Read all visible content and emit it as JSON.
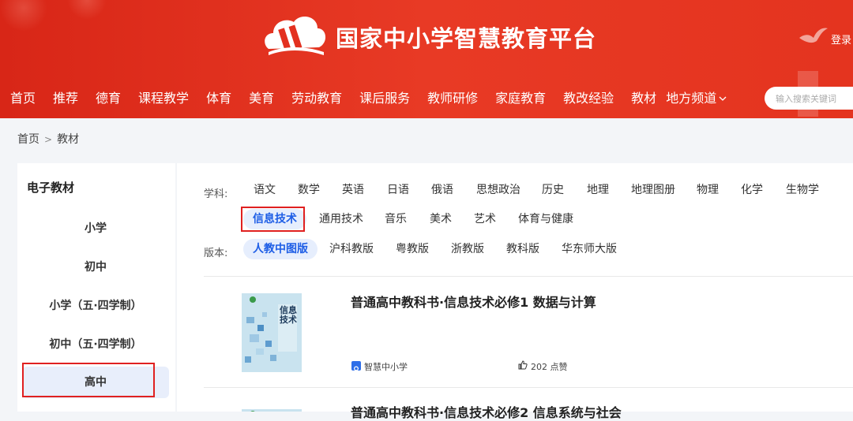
{
  "header": {
    "site_title": "国家中小学智慧教育平台",
    "login_label": "登录",
    "search_placeholder": "输入搜索关键词",
    "nav": [
      "首页",
      "推荐",
      "德育",
      "课程教学",
      "体育",
      "美育",
      "劳动教育",
      "课后服务",
      "教师研修",
      "家庭教育",
      "教改经验",
      "教材",
      "地方频道"
    ],
    "nav_dropdown_icon": "chevron-down-icon",
    "brand_color": "#e3301f"
  },
  "breadcrumb": {
    "home": "首页",
    "separator": ">",
    "current": "教材"
  },
  "sidebar": {
    "title": "电子教材",
    "items": [
      "小学",
      "初中",
      "小学（五·四学制）",
      "初中（五·四学制）",
      "高中"
    ],
    "active_item": "高中"
  },
  "filters": {
    "subject_label": "学科:",
    "subjects": [
      "语文",
      "数学",
      "英语",
      "日语",
      "俄语",
      "思想政治",
      "历史",
      "地理",
      "地理图册",
      "物理",
      "化学",
      "生物学",
      "信息技术",
      "通用技术",
      "音乐",
      "美术",
      "艺术",
      "体育与健康"
    ],
    "active_subject": "信息技术",
    "edition_label": "版本:",
    "editions": [
      "人教中图版",
      "沪科教版",
      "粤教版",
      "浙教版",
      "教科版",
      "华东师大版"
    ],
    "active_edition": "人教中图版",
    "accent_color": "#1e5ee6"
  },
  "books": [
    {
      "title": "普通高中教科书·信息技术必修1 数据与计算",
      "source": "智慧中小学",
      "likes": "202 点赞",
      "cover_text": "信息技术"
    },
    {
      "title": "普通高中教科书·信息技术必修2 信息系统与社会",
      "source": "",
      "likes": "",
      "cover_text": ""
    }
  ]
}
